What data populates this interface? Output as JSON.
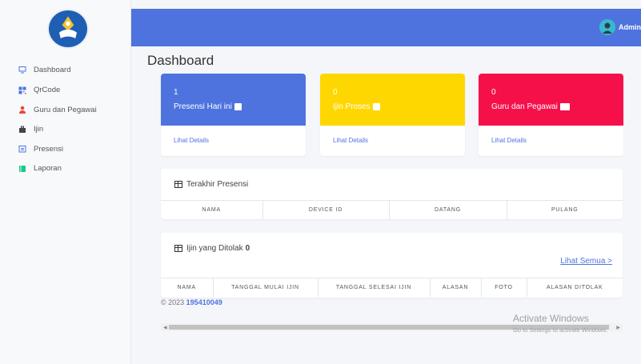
{
  "sidebar": {
    "items": [
      {
        "label": "Dashboard",
        "icon": "monitor-icon",
        "color": "#4e73df"
      },
      {
        "label": "QrCode",
        "icon": "qrcode-icon",
        "color": "#4e73df"
      },
      {
        "label": "Guru dan Pegawai",
        "icon": "user-icon",
        "color": "#e74a3b"
      },
      {
        "label": "Ijin",
        "icon": "briefcase-icon",
        "color": "#333333"
      },
      {
        "label": "Presensi",
        "icon": "calendar-icon",
        "color": "#4e73df"
      },
      {
        "label": "Laporan",
        "icon": "book-icon",
        "color": "#1cc88a"
      }
    ]
  },
  "topbar": {
    "user": "Admin",
    "color": "#4e73df"
  },
  "page_title": "Dashboard",
  "cards": [
    {
      "value": "1",
      "label": "Presensi Hari ini",
      "link": "Lihat Details",
      "color": "#4e73df"
    },
    {
      "value": "0",
      "label": "Ijin Proses",
      "link": "Lihat Details",
      "color": "#ffd700"
    },
    {
      "value": "0",
      "label": "Guru dan Pegawai",
      "link": "Lihat Details",
      "color": "#f6104a"
    }
  ],
  "presensi_table": {
    "title": "Terakhir Presensi",
    "columns": [
      "NAMA",
      "DEVICE ID",
      "DATANG",
      "PULANG"
    ]
  },
  "ijin_table": {
    "title": "Ijin yang Ditolak",
    "count": "0",
    "see_all": "Lihat Semua >",
    "columns": [
      "NAMA",
      "TANGGAL MULAI IJIN",
      "TANGGAL SELESAI IJIN",
      "ALASAN",
      "FOTO",
      "ALASAN DITOLAK"
    ]
  },
  "footer": {
    "year": "© 2023",
    "id": "195410049"
  },
  "watermark": {
    "line1": "Activate Windows",
    "line2": "Go to Settings to activate Windows."
  }
}
